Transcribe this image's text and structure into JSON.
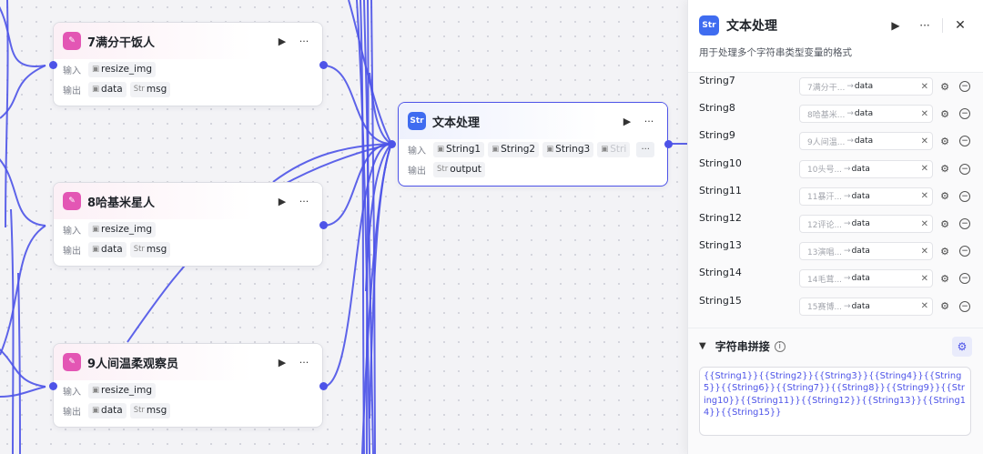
{
  "canvas": {
    "nodes": [
      {
        "title": "7满分干饭人",
        "input_label": "输入",
        "output_label": "输出",
        "inputs": [
          "resize_img"
        ],
        "outputs": [
          "data",
          "msg"
        ]
      },
      {
        "title": "8哈基米星人",
        "input_label": "输入",
        "output_label": "输出",
        "inputs": [
          "resize_img"
        ],
        "outputs": [
          "data",
          "msg"
        ]
      },
      {
        "title": "9人间温柔观察员",
        "input_label": "输入",
        "output_label": "输出",
        "inputs": [
          "resize_img"
        ],
        "outputs": [
          "data",
          "msg"
        ]
      }
    ],
    "text_node": {
      "title": "文本处理",
      "input_label": "输入",
      "output_label": "输出",
      "inputs": [
        "String1",
        "String2",
        "String3",
        "Stri"
      ],
      "more": "···",
      "outputs": [
        "output"
      ]
    },
    "icons": {
      "image_tag": "image-icon",
      "string_tag": "Str",
      "node_icon": "Str"
    },
    "accent_color": "#4d53e8",
    "node_icon_color": "#e356b4"
  },
  "panel": {
    "title": "文本处理",
    "description": "用于处理多个字符串类型变量的格式",
    "params": [
      {
        "name": "String7",
        "source": "7满分干...",
        "field": "data"
      },
      {
        "name": "String8",
        "source": "8哈基米...",
        "field": "data"
      },
      {
        "name": "String9",
        "source": "9人间温...",
        "field": "data"
      },
      {
        "name": "String10",
        "source": "10头号...",
        "field": "data"
      },
      {
        "name": "String11",
        "source": "11暴汗...",
        "field": "data"
      },
      {
        "name": "String12",
        "source": "12评论...",
        "field": "data"
      },
      {
        "name": "String13",
        "source": "13演唱...",
        "field": "data"
      },
      {
        "name": "String14",
        "source": "14毛茸...",
        "field": "data"
      },
      {
        "name": "String15",
        "source": "15赛博...",
        "field": "data"
      }
    ],
    "concat": {
      "title": "字符串拼接",
      "template": "{{String1}}{{String2}}{{String3}}{{String4}}{{String5}}{{String6}}{{String7}}{{String8}}{{String9}}{{String10}}{{String11}}{{String12}}{{String13}}{{String14}}{{String15}}"
    }
  }
}
